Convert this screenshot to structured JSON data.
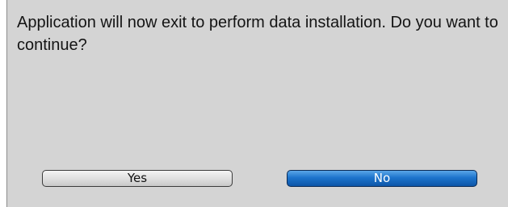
{
  "dialog": {
    "message": "Application will now exit to perform data installation. Do you want to continue?",
    "buttons": {
      "yes_label": "Yes",
      "no_label": "No"
    },
    "colors": {
      "background": "#d4d4d4",
      "selected_button": "#1d74cc",
      "default_button": "#e2e2e2"
    },
    "selected_button": "No"
  }
}
